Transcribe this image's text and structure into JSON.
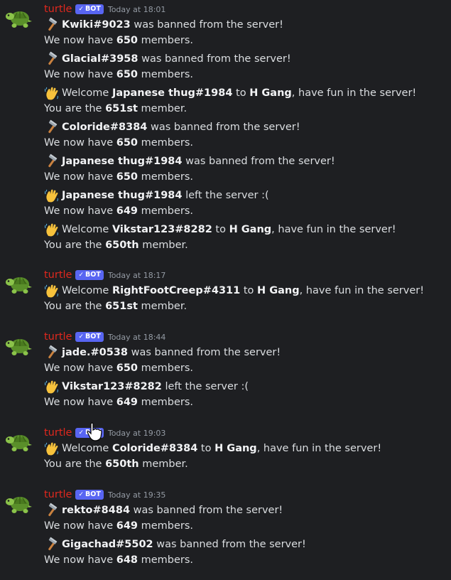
{
  "bot": {
    "name": "turtle",
    "badge": "BOT",
    "badge_check": "✓"
  },
  "groups": [
    {
      "timestamp": "Today at 18:01",
      "events": [
        {
          "icon": "hammer-icon",
          "parts": [
            {
              "t": "Kwiki#9023",
              "b": true
            },
            {
              "t": " was banned from the server!"
            }
          ],
          "sub": [
            {
              "t": "We now have "
            },
            {
              "t": "650",
              "b": true
            },
            {
              "t": " members."
            }
          ]
        },
        {
          "icon": "hammer-icon",
          "parts": [
            {
              "t": "Glacial#3958",
              "b": true
            },
            {
              "t": " was banned from the server!"
            }
          ],
          "sub": [
            {
              "t": "We now have "
            },
            {
              "t": "650",
              "b": true
            },
            {
              "t": " members."
            }
          ]
        },
        {
          "icon": "wave-icon",
          "parts": [
            {
              "t": "Welcome "
            },
            {
              "t": "Japanese thug#1984",
              "b": true
            },
            {
              "t": " to "
            },
            {
              "t": "H Gang",
              "b": true
            },
            {
              "t": ", have fun in the server!"
            }
          ],
          "sub": [
            {
              "t": "You are the "
            },
            {
              "t": "651st",
              "b": true
            },
            {
              "t": " member."
            }
          ]
        },
        {
          "icon": "hammer-icon",
          "parts": [
            {
              "t": "Coloride#8384",
              "b": true
            },
            {
              "t": " was banned from the server!"
            }
          ],
          "sub": [
            {
              "t": "We now have "
            },
            {
              "t": "650",
              "b": true
            },
            {
              "t": " members."
            }
          ]
        },
        {
          "icon": "hammer-icon",
          "parts": [
            {
              "t": "Japanese thug#1984",
              "b": true
            },
            {
              "t": " was banned from the server!"
            }
          ],
          "sub": [
            {
              "t": "We now have "
            },
            {
              "t": "650",
              "b": true
            },
            {
              "t": " members."
            }
          ]
        },
        {
          "icon": "wave-icon",
          "parts": [
            {
              "t": "Japanese thug#1984",
              "b": true
            },
            {
              "t": " left the server :("
            }
          ],
          "sub": [
            {
              "t": "We now have "
            },
            {
              "t": "649",
              "b": true
            },
            {
              "t": " members."
            }
          ]
        },
        {
          "icon": "wave-icon",
          "parts": [
            {
              "t": "Welcome "
            },
            {
              "t": "Vikstar123#8282",
              "b": true
            },
            {
              "t": " to "
            },
            {
              "t": "H Gang",
              "b": true
            },
            {
              "t": ", have fun in the server!"
            }
          ],
          "sub": [
            {
              "t": "You are the "
            },
            {
              "t": "650th",
              "b": true
            },
            {
              "t": " member."
            }
          ]
        }
      ]
    },
    {
      "timestamp": "Today at 18:17",
      "events": [
        {
          "icon": "wave-icon",
          "parts": [
            {
              "t": "Welcome "
            },
            {
              "t": "RightFootCreep#4311",
              "b": true
            },
            {
              "t": " to "
            },
            {
              "t": "H Gang",
              "b": true
            },
            {
              "t": ", have fun in the server!"
            }
          ],
          "sub": [
            {
              "t": "You are the "
            },
            {
              "t": "651st",
              "b": true
            },
            {
              "t": " member."
            }
          ]
        }
      ]
    },
    {
      "timestamp": "Today at 18:44",
      "events": [
        {
          "icon": "hammer-icon",
          "parts": [
            {
              "t": "jade.#0538",
              "b": true
            },
            {
              "t": " was banned from the server!"
            }
          ],
          "sub": [
            {
              "t": "We now have "
            },
            {
              "t": "650",
              "b": true
            },
            {
              "t": " members."
            }
          ]
        },
        {
          "icon": "wave-icon",
          "parts": [
            {
              "t": "Vikstar123#8282",
              "b": true
            },
            {
              "t": " left the server :("
            }
          ],
          "sub": [
            {
              "t": "We now have "
            },
            {
              "t": "649",
              "b": true
            },
            {
              "t": " members."
            }
          ]
        }
      ]
    },
    {
      "timestamp": "Today at 19:03",
      "events": [
        {
          "icon": "wave-icon",
          "parts": [
            {
              "t": "Welcome "
            },
            {
              "t": "Coloride#8384",
              "b": true
            },
            {
              "t": " to "
            },
            {
              "t": "H Gang",
              "b": true
            },
            {
              "t": ", have fun in the server!"
            }
          ],
          "sub": [
            {
              "t": "You are the "
            },
            {
              "t": "650th",
              "b": true
            },
            {
              "t": " member."
            }
          ]
        }
      ]
    },
    {
      "timestamp": "Today at 19:35",
      "events": [
        {
          "icon": "hammer-icon",
          "parts": [
            {
              "t": "rekto#8484",
              "b": true
            },
            {
              "t": " was banned from the server!"
            }
          ],
          "sub": [
            {
              "t": "We now have "
            },
            {
              "t": "649",
              "b": true
            },
            {
              "t": " members."
            }
          ]
        },
        {
          "icon": "hammer-icon",
          "parts": [
            {
              "t": "Gigachad#5502",
              "b": true
            },
            {
              "t": " was banned from the server!"
            }
          ],
          "sub": [
            {
              "t": "We now have "
            },
            {
              "t": "648",
              "b": true
            },
            {
              "t": " members."
            }
          ]
        }
      ]
    }
  ]
}
